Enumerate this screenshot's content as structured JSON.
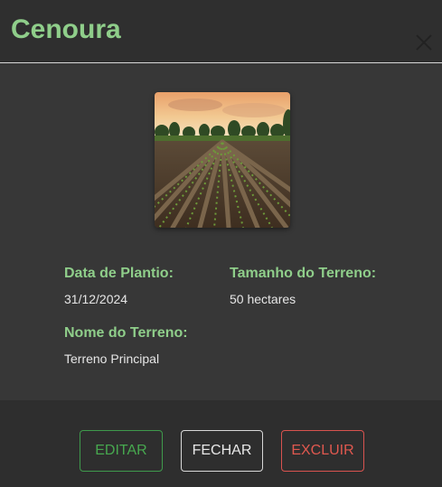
{
  "modal": {
    "title": "Cenoura",
    "image_alt": "Campo de plantio"
  },
  "fields": {
    "planting_date": {
      "label": "Data de Plantio:",
      "value": "31/12/2024"
    },
    "land_size": {
      "label": "Tamanho do Terreno:",
      "value": "50 hectares"
    },
    "land_name": {
      "label": "Nome do Terreno:",
      "value": "Terreno Principal"
    }
  },
  "footer": {
    "edit_label": "EDITAR",
    "close_label": "FECHAR",
    "delete_label": "EXCLUIR"
  },
  "colors": {
    "accent_green": "#8fce8a",
    "edit_green": "#47a84f",
    "delete_red": "#e0584f",
    "background": "#373737"
  },
  "icons": {
    "close": "close-icon"
  }
}
